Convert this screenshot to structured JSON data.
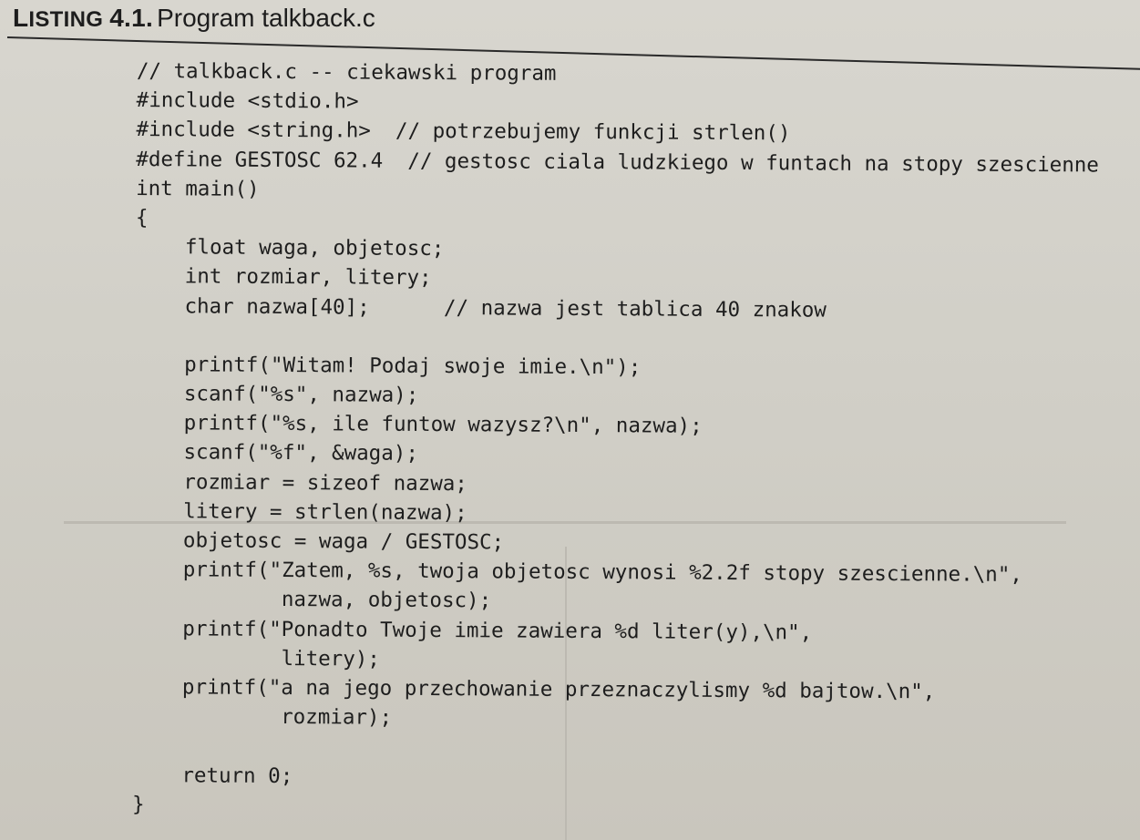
{
  "listing": {
    "label_cap": "L",
    "label_rest": "ISTING",
    "number": "4.1.",
    "title": "Program talkback.c"
  },
  "code_lines": [
    "// talkback.c -- ciekawski program",
    "#include <stdio.h>",
    "#include <string.h>  // potrzebujemy funkcji strlen()",
    "#define GESTOSC 62.4  // gestosc ciala ludzkiego w funtach na stopy szescienne",
    "int main()",
    "{",
    "    float waga, objetosc;",
    "    int rozmiar, litery;",
    "    char nazwa[40];      // nazwa jest tablica 40 znakow",
    "",
    "    printf(\"Witam! Podaj swoje imie.\\n\");",
    "    scanf(\"%s\", nazwa);",
    "    printf(\"%s, ile funtow wazysz?\\n\", nazwa);",
    "    scanf(\"%f\", &waga);",
    "    rozmiar = sizeof nazwa;",
    "    litery = strlen(nazwa);",
    "    objetosc = waga / GESTOSC;",
    "    printf(\"Zatem, %s, twoja objetosc wynosi %2.2f stopy szescienne.\\n\",",
    "            nazwa, objetosc);",
    "    printf(\"Ponadto Twoje imie zawiera %d liter(y),\\n\",",
    "            litery);",
    "    printf(\"a na jego przechowanie przeznaczylismy %d bajtow.\\n\",",
    "            rozmiar);",
    "",
    "    return 0;",
    "}"
  ]
}
